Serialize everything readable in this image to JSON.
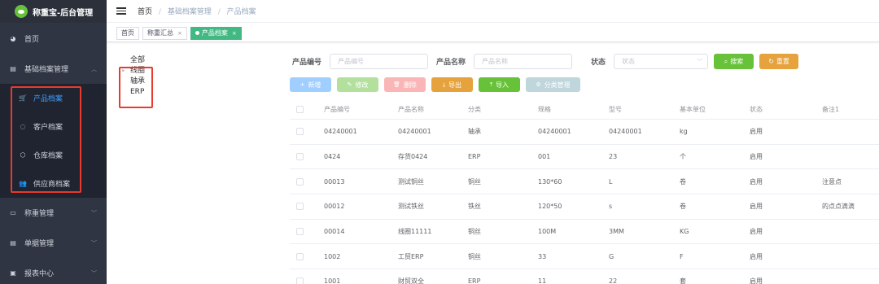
{
  "app": {
    "title": "称重宝-后台管理"
  },
  "sidebar": {
    "home": "首页",
    "basic": "基础档案管理",
    "sub": [
      "产品档案",
      "客户档案",
      "仓库档案",
      "供应商档案"
    ],
    "weigh": "称重管理",
    "docs": "单据管理",
    "report": "报表中心"
  },
  "breadcrumb": {
    "home": "首页",
    "sep": "/",
    "level1": "基础档案管理",
    "current": "产品档案"
  },
  "tags": {
    "home": "首页",
    "summary": "称重汇总",
    "current": "产品档案"
  },
  "tree": {
    "root": "全部",
    "nodes": [
      "线圈",
      "轴承",
      "ERP"
    ]
  },
  "search": {
    "code_label": "产品编号",
    "code_placeholder": "产品编号",
    "name_label": "产品名称",
    "name_placeholder": "产品名称",
    "status_label": "状态",
    "status_placeholder": "状态",
    "search_btn": "搜索",
    "reset_btn": "重置"
  },
  "toolbar": {
    "add": "新增",
    "edit": "修改",
    "delete": "删除",
    "export": "导出",
    "import": "导入",
    "category": "分类管理"
  },
  "table": {
    "headers": [
      "产品编号",
      "产品名称",
      "分类",
      "规格",
      "型号",
      "基本单位",
      "状态",
      "备注1"
    ],
    "rows": [
      [
        "04240001",
        "04240001",
        "轴承",
        "04240001",
        "04240001",
        "kg",
        "启用",
        ""
      ],
      [
        "0424",
        "存货0424",
        "ERP",
        "001",
        "23",
        "个",
        "启用",
        ""
      ],
      [
        "00013",
        "测试铜丝",
        "铜丝",
        "130*60",
        "L",
        "卷",
        "启用",
        "注意点"
      ],
      [
        "00012",
        "测试铁丝",
        "铁丝",
        "120*50",
        "s",
        "卷",
        "启用",
        "的点点滴滴"
      ],
      [
        "00014",
        "线圈11111",
        "铜丝",
        "100M",
        "3MM",
        "KG",
        "启用",
        ""
      ],
      [
        "1002",
        "工贸ERP",
        "铜丝",
        "33",
        "G",
        "F",
        "启用",
        ""
      ],
      [
        "1001",
        "财贸双全",
        "ERP",
        "11",
        "22",
        "套",
        "启用",
        ""
      ]
    ]
  },
  "colors": {
    "sidebar_bg": "#2f3542",
    "active_blue": "#409eff",
    "tag_green": "#42b983",
    "highlight_red": "#e63b2e"
  }
}
